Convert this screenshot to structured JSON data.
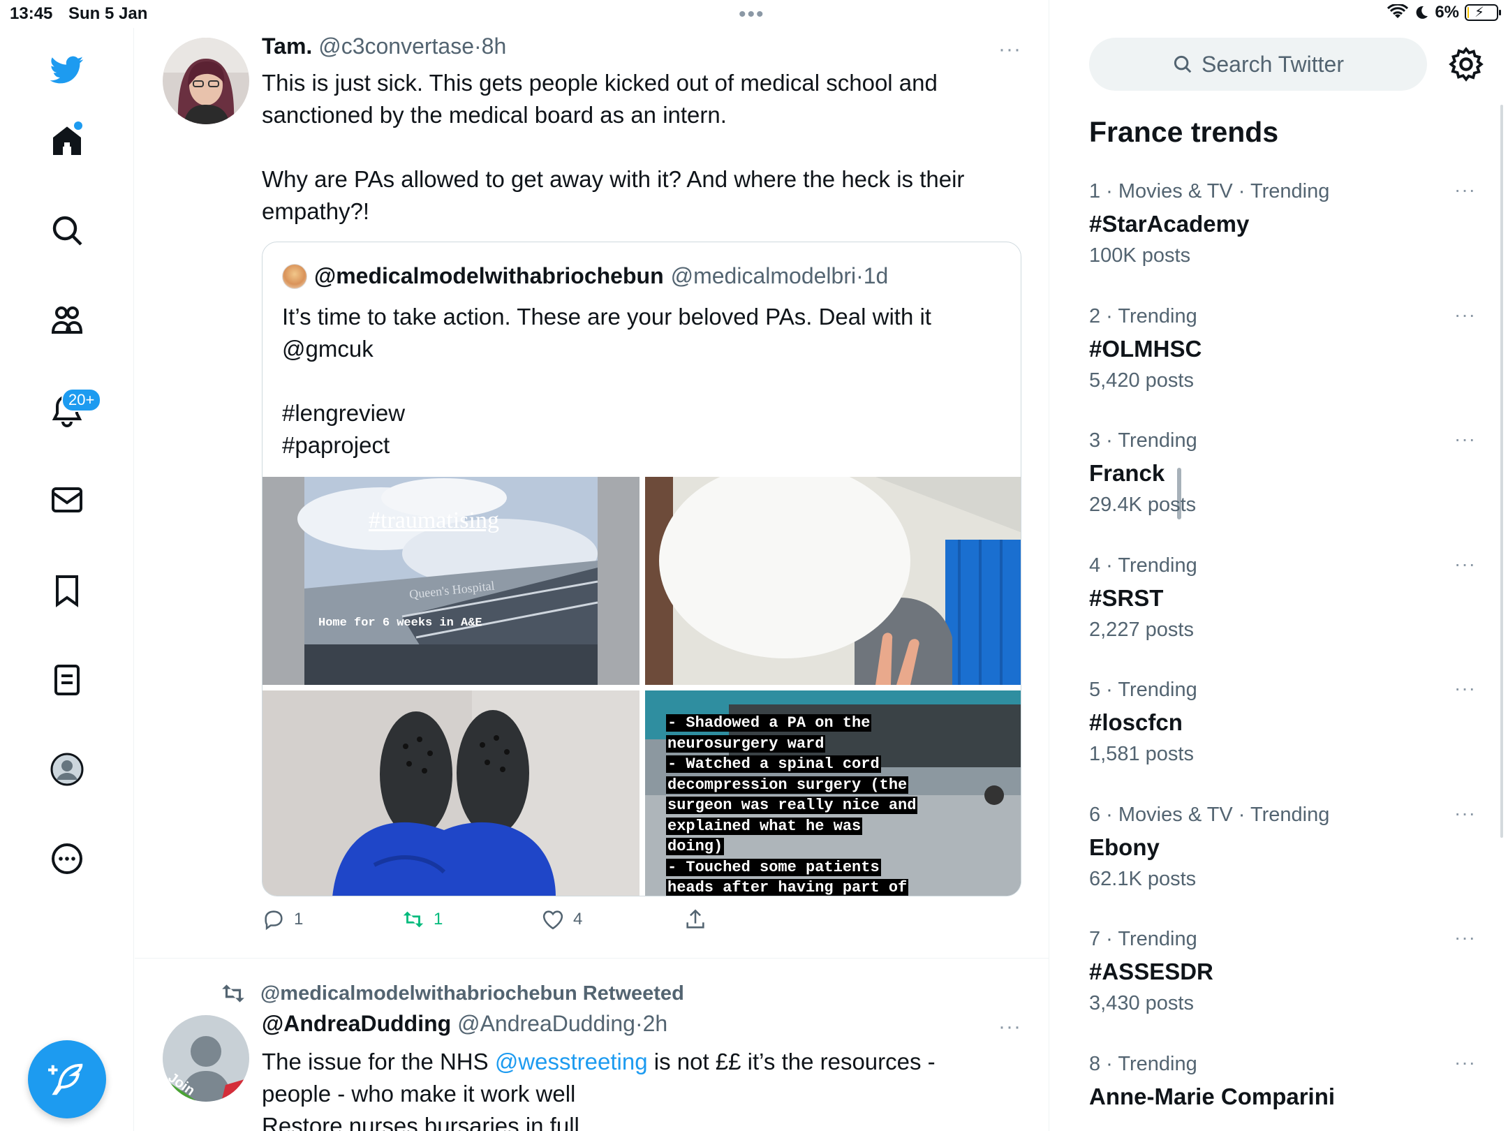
{
  "status_bar": {
    "time": "13:45",
    "date": "Sun 5 Jan",
    "battery": "6%",
    "battery_level": 0.06
  },
  "nav": {
    "notifications_badge": "20+"
  },
  "tweet1": {
    "name": "Tam.",
    "handle": "@c3convertase",
    "sep": "·",
    "time": "8h",
    "more": "···",
    "body_lines": [
      "This is just sick. This gets people kicked out of medical school and",
      "sanctioned by the medical board as an intern.",
      "Why are PAs allowed to get away with it? And where the heck is their",
      "empathy?!"
    ],
    "quote": {
      "name": "@medicalmodelwithabriochebun",
      "handle": "@medicalmodelbri",
      "sep": "·",
      "time": "1d",
      "body_lines": [
        "It’s time to take action. These are your beloved PAs. Deal with it",
        "@gmcuk",
        "#lengreview",
        "#paproject"
      ],
      "image1_overlay_title": "#traumatising",
      "image1_sign": "Queen's Hospital",
      "image1_caption": "Home for 6 weeks in A&E",
      "image4_lines": [
        "- Shadowed a PA on the",
        "neurosurgery ward",
        "- Watched a spinal cord",
        "decompression surgery (the",
        "surgeon was really nice and",
        "explained what he was",
        "doing)",
        "- Touched some patients",
        "heads after having part of"
      ]
    },
    "actions": {
      "replies": "1",
      "retweets": "1",
      "likes": "4"
    }
  },
  "tweet2": {
    "retweeted_by": "@medicalmodelwithabriochebun Retweeted",
    "name": "@AndreaDudding",
    "handle": "@AndreaDudding",
    "sep": "·",
    "time": "2h",
    "more": "···",
    "body_pre": "The issue for the NHS ",
    "body_mention": "@wesstreeting",
    "body_post": " is not ££ it’s the resources -",
    "body_line2": "people - who make it work well",
    "body_line3": "Restore nurses bursaries in full",
    "avatar_label": "Join"
  },
  "sidebar": {
    "search_placeholder": "Search Twitter",
    "trends_title": "France trends",
    "trends": [
      {
        "meta": "1 · Movies & TV · Trending",
        "name": "#StarAcademy",
        "posts": "100K posts"
      },
      {
        "meta": "2 · Trending",
        "name": "#OLMHSC",
        "posts": "5,420 posts"
      },
      {
        "meta": "3 · Trending",
        "name": "Franck",
        "posts": "29.4K posts"
      },
      {
        "meta": "4 · Trending",
        "name": "#SRST",
        "posts": "2,227 posts"
      },
      {
        "meta": "5 · Trending",
        "name": "#loscfcn",
        "posts": "1,581 posts"
      },
      {
        "meta": "6 · Movies & TV · Trending",
        "name": "Ebony",
        "posts": "62.1K posts"
      },
      {
        "meta": "7 · Trending",
        "name": "#ASSESDR",
        "posts": "3,430 posts"
      },
      {
        "meta": "8 · Trending",
        "name": "Anne-Marie Comparini",
        "posts": ""
      }
    ],
    "trend_more": "···"
  },
  "colors": {
    "accent": "#1d9bf0",
    "retweet_green": "#00ba7c",
    "secondary_text": "#536471"
  }
}
